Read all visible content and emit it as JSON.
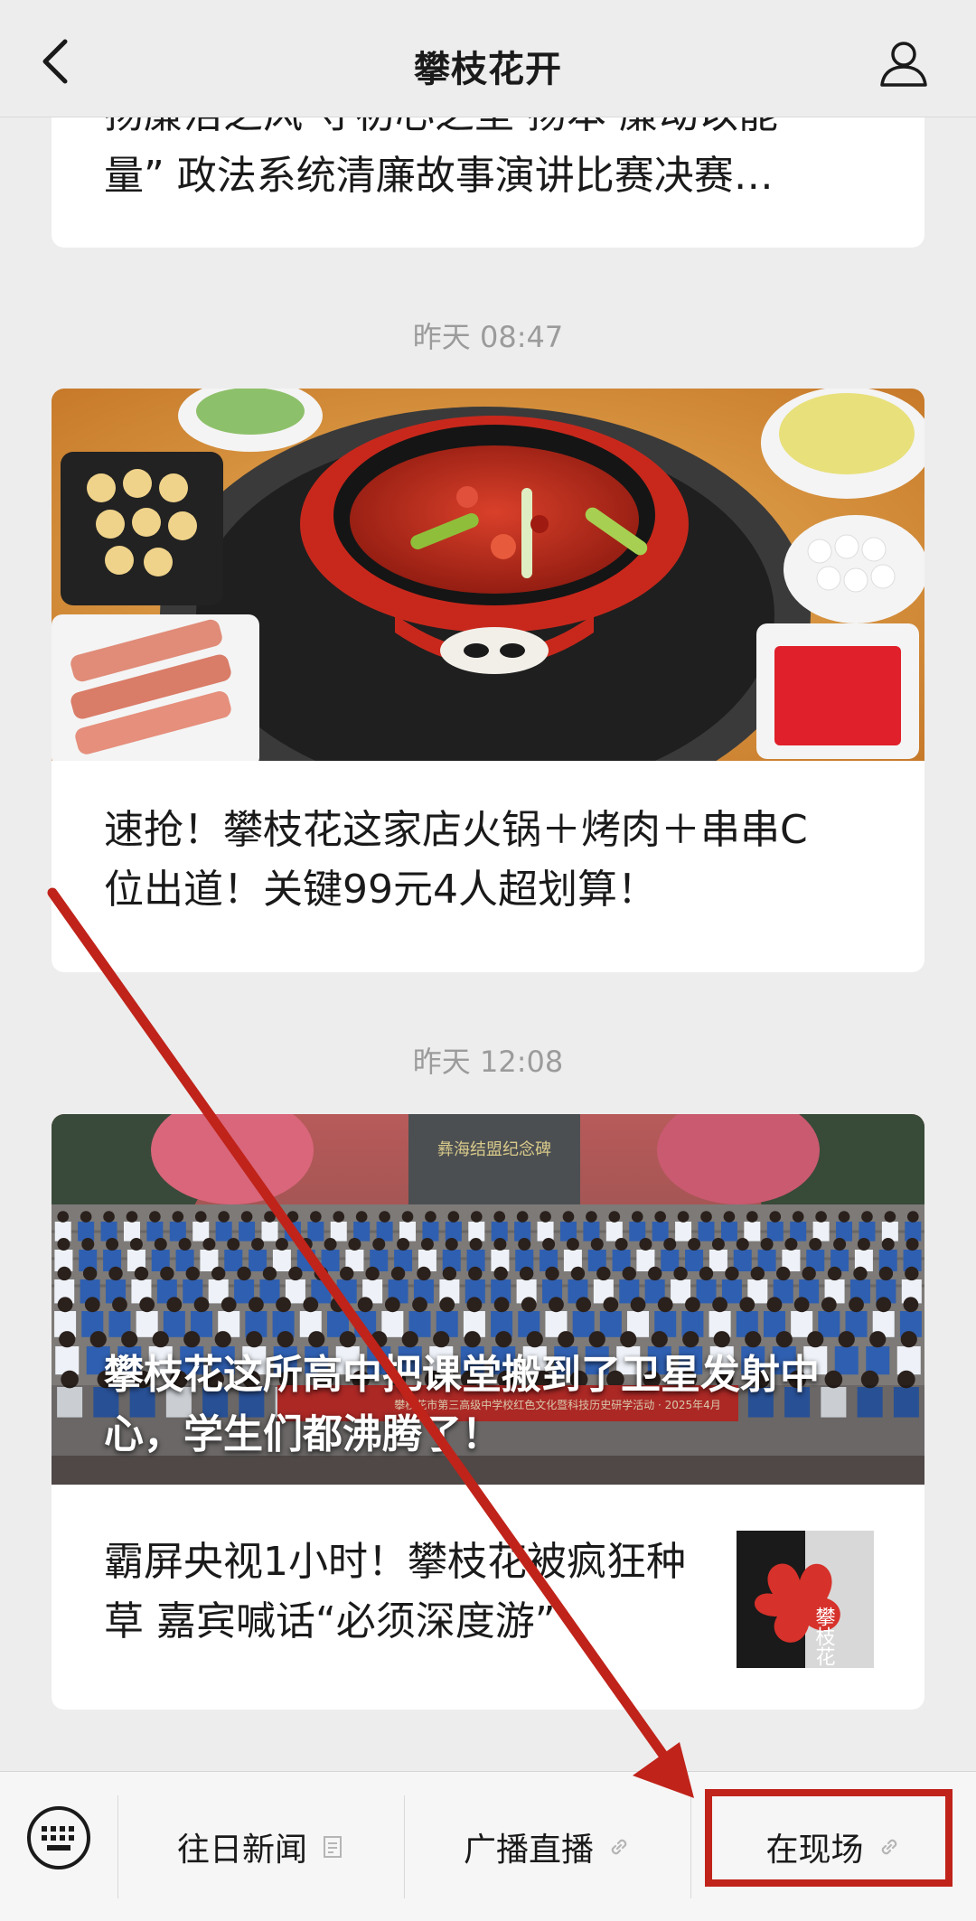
{
  "header": {
    "title": "攀枝花开",
    "back_icon": "chevron-left-icon",
    "user_icon": "person-icon"
  },
  "feed": {
    "top_card_text": "量” 政法系统清廉故事演讲比赛决赛…",
    "top_card_partial": "扬廉洁之风 守初心之坚 扬本 廉动以能",
    "timestamp_1": "昨天 08:47",
    "article_1_title": "速抢！攀枝花这家店火锅＋烤肉＋串串C位出道！关键99元4人超划算！",
    "timestamp_2": "昨天 12:08",
    "article_2_title": "攀枝花这所高中把课堂搬到了卫星发射中心，学生们都沸腾了！",
    "article_2_photo_caption": "攀枝花市第三高级中学校红色文化暨科技历史研学活动 · 2025年4月",
    "article_2_monument_text": "彝海结盟纪念碑",
    "article_3_title": "霸屏央视1小时！攀枝花被疯狂种草 嘉宾喊话“必须深度游”",
    "article_3_thumb_text": "攀枝花"
  },
  "bottom_menu": {
    "keyboard_icon": "keyboard-icon",
    "items": [
      {
        "label": "往日新闻",
        "icon": "document-icon"
      },
      {
        "label": "广播直播",
        "icon": "link-icon"
      },
      {
        "label": "在现场",
        "icon": "link-icon"
      }
    ]
  },
  "annotation": {
    "arrow_color": "#c0231a",
    "highlight_color": "#c0231a"
  }
}
